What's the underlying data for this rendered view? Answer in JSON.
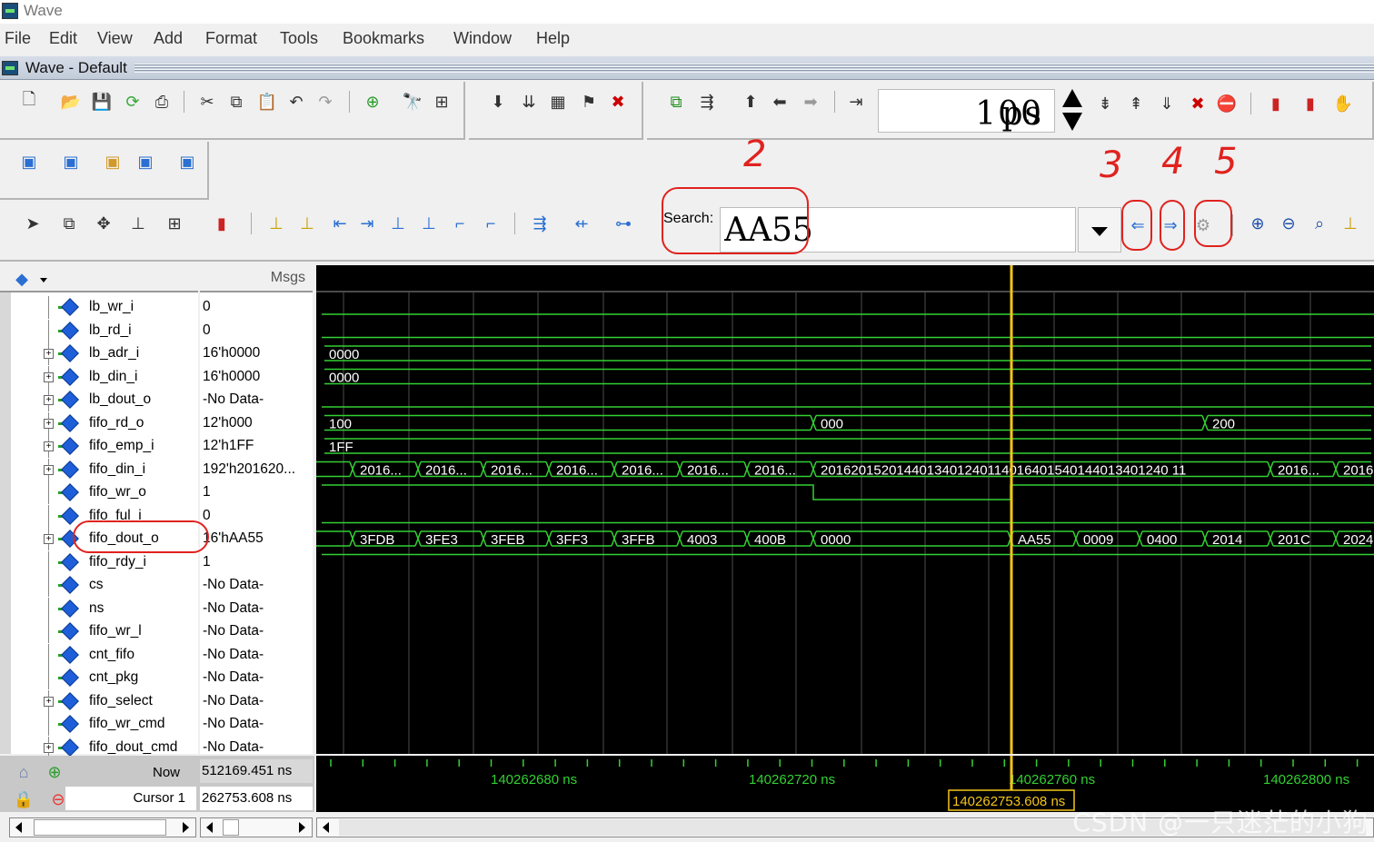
{
  "app_title": "Wave",
  "menu": [
    "File",
    "Edit",
    "View",
    "Add",
    "Format",
    "Tools",
    "Bookmarks",
    "Window",
    "Help"
  ],
  "subwindow_title": "Wave - Default",
  "time_step": {
    "value": "100",
    "unit": "ps"
  },
  "search": {
    "label": "Search:",
    "value": "AA55"
  },
  "annotations": [
    "2",
    "3",
    "4",
    "5"
  ],
  "msgs_header": "Msgs",
  "signals": [
    {
      "name": "lb_wr_i",
      "value": "0",
      "expandable": false
    },
    {
      "name": "lb_rd_i",
      "value": "0",
      "expandable": false
    },
    {
      "name": "lb_adr_i",
      "value": "16'h0000",
      "expandable": true
    },
    {
      "name": "lb_din_i",
      "value": "16'h0000",
      "expandable": true
    },
    {
      "name": "lb_dout_o",
      "value": "-No Data-",
      "expandable": true
    },
    {
      "name": "fifo_rd_o",
      "value": "12'h000",
      "expandable": true
    },
    {
      "name": "fifo_emp_i",
      "value": "12'h1FF",
      "expandable": true
    },
    {
      "name": "fifo_din_i",
      "value": "192'h201620...",
      "expandable": true
    },
    {
      "name": "fifo_wr_o",
      "value": "1",
      "expandable": false
    },
    {
      "name": "fifo_ful_i",
      "value": "0",
      "expandable": false
    },
    {
      "name": "fifo_dout_o",
      "value": "16'hAA55",
      "expandable": true,
      "selected": true
    },
    {
      "name": "fifo_rdy_i",
      "value": "1",
      "expandable": false
    },
    {
      "name": "cs",
      "value": "-No Data-",
      "expandable": false
    },
    {
      "name": "ns",
      "value": "-No Data-",
      "expandable": false
    },
    {
      "name": "fifo_wr_l",
      "value": "-No Data-",
      "expandable": false
    },
    {
      "name": "cnt_fifo",
      "value": "-No Data-",
      "expandable": false
    },
    {
      "name": "cnt_pkg",
      "value": "-No Data-",
      "expandable": false
    },
    {
      "name": "fifo_select",
      "value": "-No Data-",
      "expandable": true
    },
    {
      "name": "fifo_wr_cmd",
      "value": "-No Data-",
      "expandable": false
    },
    {
      "name": "fifo_dout_cmd",
      "value": "-No Data-",
      "expandable": true
    }
  ],
  "waves": {
    "lb_adr_i": [
      "0000"
    ],
    "lb_din_i": [
      "0000"
    ],
    "fifo_rd_o": [
      "100",
      "000",
      "200"
    ],
    "fifo_emp_i": [
      "1FF"
    ],
    "fifo_din_i": [
      "2016...",
      "2016...",
      "2016...",
      "2016...",
      "2016...",
      "2016...",
      "2016...",
      "2016201520144013401240114016401540144013401240 11",
      "2016...",
      "2016"
    ],
    "fifo_dout_o": [
      "3FDB",
      "3FE3",
      "3FEB",
      "3FF3",
      "3FFB",
      "4003",
      "400B",
      "0000",
      "AA55",
      "0009",
      "0400",
      "2014",
      "201C",
      "2024"
    ]
  },
  "status": {
    "now_label": "Now",
    "now_value": "512169.451 ns",
    "cursor_label": "Cursor 1",
    "cursor_value": "262753.608 ns",
    "cursor_flag": "140262753.608 ns"
  },
  "timeline_labels": [
    "140262680 ns",
    "140262720 ns",
    "140262760 ns",
    "140262800 ns"
  ],
  "colors": {
    "wave": "#33d033",
    "cursor": "#f5c518",
    "annotation": "#e0221e",
    "timeline_text": "#33d033"
  },
  "watermark": "CSDN @一只迷茫的小狗"
}
